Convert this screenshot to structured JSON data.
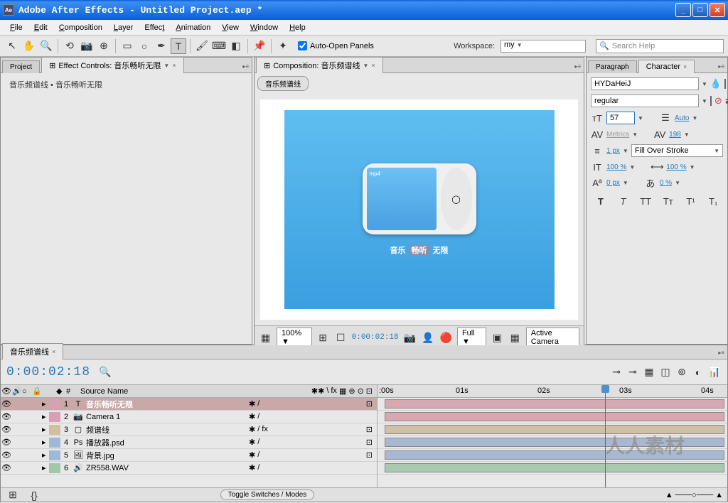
{
  "window": {
    "app_logo": "Ae",
    "title": "Adobe After Effects - Untitled Project.aep *"
  },
  "menu": {
    "file": "File",
    "edit": "Edit",
    "composition": "Composition",
    "layer": "Layer",
    "effect": "Effect",
    "animation": "Animation",
    "view": "View",
    "window": "Window",
    "help": "Help"
  },
  "toolbar": {
    "auto_open": "Auto-Open Panels",
    "workspace_label": "Workspace:",
    "workspace_value": "my",
    "search_placeholder": "Search Help"
  },
  "left_panel": {
    "project_tab": "Project",
    "effect_controls_tab": "Effect Controls: 音乐畅听无限",
    "effect_header": "音乐频谱线 • 音乐畅听无限"
  },
  "comp_panel": {
    "tab": "Composition: 音乐频谱线",
    "breadcrumb": "音乐频谱线",
    "text_1": "音乐",
    "text_2": "畅听",
    "text_3": "无限",
    "device_label": "mp4",
    "zoom": "100%",
    "timecode": "0:00:02:18",
    "resolution": "Full",
    "camera": "Active Camera"
  },
  "char_panel": {
    "tab_paragraph": "Paragraph",
    "tab_character": "Character",
    "font": "HYDaHeiJ",
    "style": "regular",
    "size": "57",
    "leading": "Auto",
    "kerning": "Metrics",
    "tracking": "198",
    "stroke_width": "1 px",
    "stroke_mode": "Fill Over Stroke",
    "vscale": "100 %",
    "hscale": "100 %",
    "baseline": "0 px",
    "tsume": "0 %",
    "fill_color": "#5aaae6",
    "stroke_color": "#000000"
  },
  "timeline": {
    "tab": "音乐频谱线",
    "timecode": "0:00:02:18",
    "col_source": "Source Name",
    "toggle_label": "Toggle Switches / Modes",
    "ruler": {
      "t0": ":00s",
      "t1": "01s",
      "t2": "02s",
      "t3": "03s",
      "t4": "04s"
    },
    "layers": [
      {
        "num": "1",
        "name": "音乐畅听无限",
        "icon": "T",
        "color": "c-pink",
        "selected": true
      },
      {
        "num": "2",
        "name": "Camera 1",
        "icon": "📷",
        "color": "c-pink",
        "selected": false
      },
      {
        "num": "3",
        "name": "频谱线",
        "icon": "▢",
        "color": "c-tan",
        "selected": false
      },
      {
        "num": "4",
        "name": "播放器.psd",
        "icon": "Ps",
        "color": "c-blue",
        "selected": false
      },
      {
        "num": "5",
        "name": "背景.jpg",
        "icon": "🖼",
        "color": "c-blue",
        "selected": false
      },
      {
        "num": "6",
        "name": "ZR558.WAV",
        "icon": "🔊",
        "color": "c-green",
        "selected": false
      }
    ]
  }
}
